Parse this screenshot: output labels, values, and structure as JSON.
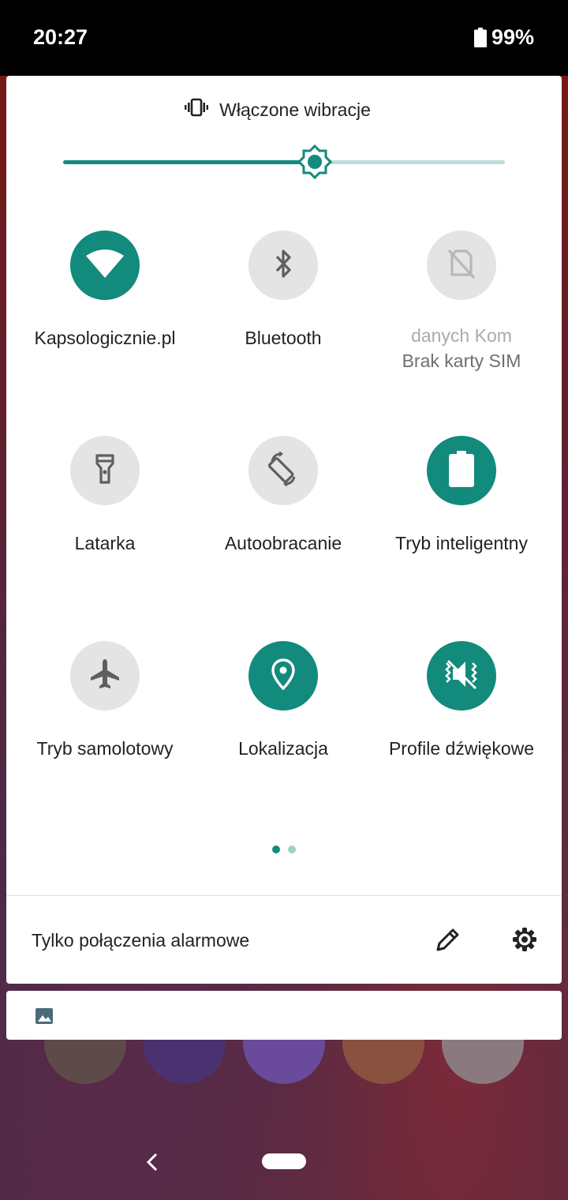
{
  "status_bar": {
    "time": "20:27",
    "battery": "99%"
  },
  "ringer": {
    "label": "Włączone wibracje",
    "icon": "vibrate-icon"
  },
  "brightness": {
    "level": 0.57,
    "icon": "brightness-icon"
  },
  "tiles": [
    {
      "id": "wifi",
      "label": "Kapsologicznie.pl",
      "icon": "wifi-icon",
      "active": true
    },
    {
      "id": "bluetooth",
      "label": "Bluetooth",
      "icon": "bluetooth-icon",
      "active": false
    },
    {
      "id": "mobile-data",
      "marquee": "danych        Kom",
      "sublabel": "Brak karty SIM",
      "icon": "no-sim-icon",
      "active": false
    },
    {
      "id": "flashlight",
      "label": "Latarka",
      "icon": "flashlight-icon",
      "active": false
    },
    {
      "id": "autorotate",
      "label": "Autoobracanie",
      "icon": "autorotate-icon",
      "active": false
    },
    {
      "id": "smart-mode",
      "label": "Tryb inteligentny",
      "icon": "battery-icon",
      "active": true
    },
    {
      "id": "airplane",
      "label": "Tryb samolotowy",
      "icon": "airplane-icon",
      "active": false
    },
    {
      "id": "location",
      "label": "Lokalizacja",
      "icon": "location-icon",
      "active": true
    },
    {
      "id": "sound-profiles",
      "label": "Profile dźwiękowe",
      "icon": "sound-profile-icon",
      "active": true
    }
  ],
  "pager": {
    "current": 1,
    "total": 2
  },
  "footer": {
    "text": "Tylko połączenia alarmowe",
    "edit_icon": "pencil-icon",
    "settings_icon": "gear-icon"
  },
  "notification": {
    "icon": "image-icon"
  },
  "colors": {
    "accent": "#128a7c",
    "accent_light": "#b9ddd8",
    "tile_off": "#e4e4e4",
    "icon_off": "#5f5f5f"
  }
}
